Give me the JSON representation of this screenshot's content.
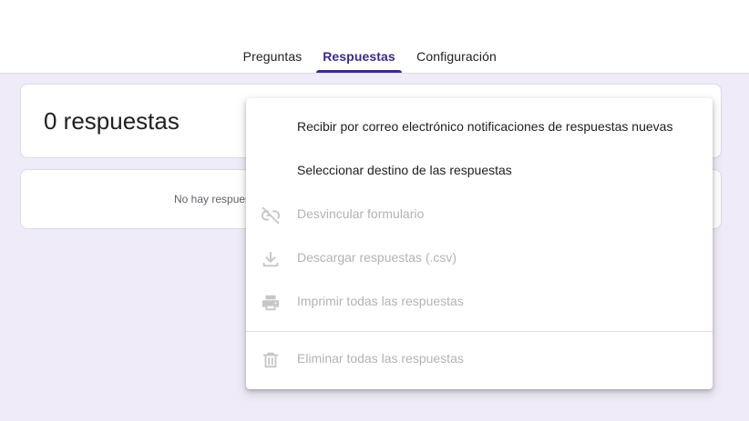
{
  "tabs": {
    "preguntas": "Preguntas",
    "respuestas": "Respuestas",
    "configuracion": "Configuración"
  },
  "summary": {
    "count_title": "0 respuestas",
    "empty_message": "No hay respuestas"
  },
  "menu": {
    "notify": "Recibir por correo electrónico notificaciones de respuestas nuevas",
    "destination": "Seleccionar destino de las respuestas",
    "unlink": "Desvincular formulario",
    "download": "Descargar respuestas (.csv)",
    "print": "Imprimir todas las respuestas",
    "delete": "Eliminar todas las respuestas"
  },
  "icons": {
    "unlink": "link-off-icon",
    "download": "download-icon",
    "print": "print-icon",
    "delete": "trash-icon"
  },
  "colors": {
    "accent": "#3c2a89",
    "page_background": "#f0ebf8",
    "disabled_text": "#b1b3b6"
  }
}
